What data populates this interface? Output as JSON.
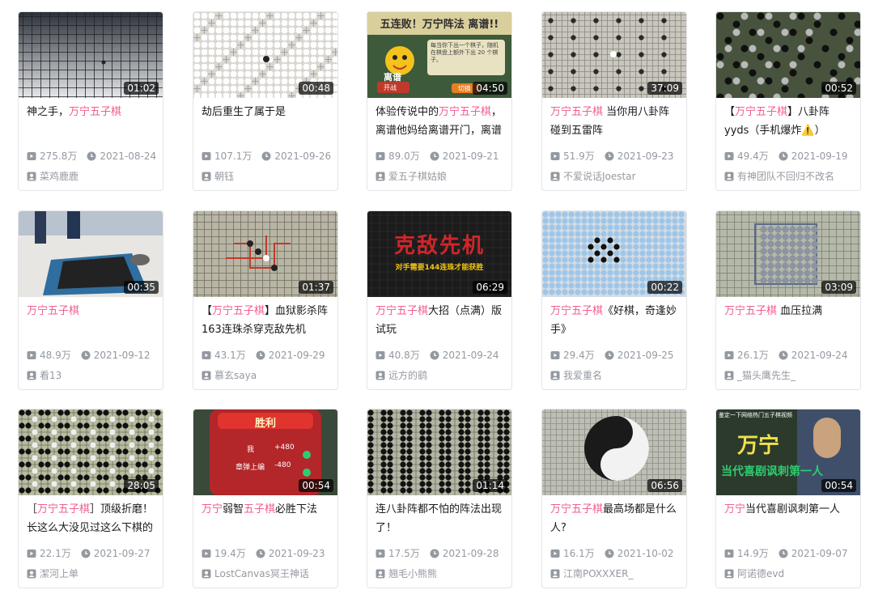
{
  "cards": [
    {
      "duration": "01:02",
      "title": [
        {
          "t": "神之手，",
          "h": false
        },
        {
          "t": "万宁五子棋",
          "h": true
        }
      ],
      "views": "275.8万",
      "date": "2021-08-24",
      "author": "菜鸡鹿鹿",
      "thumb": "board-dark"
    },
    {
      "duration": "00:48",
      "title": [
        {
          "t": "劫后重生了属于是",
          "h": false
        }
      ],
      "views": "107.1万",
      "date": "2021-09-26",
      "author": "朝钰",
      "thumb": "board-white"
    },
    {
      "duration": "04:50",
      "title": [
        {
          "t": "体验传说中的",
          "h": false
        },
        {
          "t": "万宁五子棋",
          "h": true
        },
        {
          "t": "，离谱他妈给离谱开门，离谱",
          "h": false
        }
      ],
      "views": "89.0万",
      "date": "2021-09-21",
      "author": "爱五子棋姑娘",
      "thumb": "game-cartoon",
      "thumb_text": {
        "banner": "五连败！万宁阵法 离谱!!",
        "hint": "每当你下出一个棋子，随机在棋盘上额外下出 20 个棋子。",
        "label": "离谱",
        "btn_left": "开战",
        "btn_right": "切换"
      }
    },
    {
      "duration": "37:09",
      "title": [
        {
          "t": "万宁五子棋",
          "h": true
        },
        {
          "t": " 当你用八卦阵碰到五雷阵",
          "h": false
        }
      ],
      "views": "51.9万",
      "date": "2021-09-23",
      "author": "不爱说话Joestar",
      "thumb": "board-light"
    },
    {
      "duration": "00:52",
      "title": [
        {
          "t": "【",
          "h": false
        },
        {
          "t": "万宁五子棋",
          "h": true
        },
        {
          "t": "】八卦阵yyds（手机爆炸⚠️）",
          "h": false
        }
      ],
      "views": "49.4万",
      "date": "2021-09-19",
      "author": "有神团队不回归不改名",
      "thumb": "board-yinyang"
    },
    {
      "duration": "00:35",
      "title": [
        {
          "t": "万宁五子棋",
          "h": true
        }
      ],
      "views": "48.9万",
      "date": "2021-09-12",
      "author": "看13",
      "thumb": "photo-table"
    },
    {
      "duration": "01:37",
      "title": [
        {
          "t": "【",
          "h": false
        },
        {
          "t": "万宁五子棋",
          "h": true
        },
        {
          "t": "】血狱影杀阵163连珠杀穿克敌先机",
          "h": false
        }
      ],
      "views": "43.1万",
      "date": "2021-09-29",
      "author": "慕玄saya",
      "thumb": "board-red"
    },
    {
      "duration": "06:29",
      "title": [
        {
          "t": "万宁五子棋",
          "h": true
        },
        {
          "t": "大招（点满）版试玩",
          "h": false
        }
      ],
      "views": "40.8万",
      "date": "2021-09-24",
      "author": "远方的鹞",
      "thumb": "text-red",
      "thumb_text": {
        "big": "克敌先机",
        "sub": "对手需要144连珠才能获胜"
      }
    },
    {
      "duration": "00:22",
      "title": [
        {
          "t": "万宁五子棋",
          "h": true
        },
        {
          "t": "《好棋，奇逢妙手》",
          "h": false
        }
      ],
      "views": "29.4万",
      "date": "2021-09-25",
      "author": "我爱重名",
      "thumb": "board-blue"
    },
    {
      "duration": "03:09",
      "title": [
        {
          "t": "万宁五子棋",
          "h": true
        },
        {
          "t": " 血压拉满",
          "h": false
        }
      ],
      "views": "26.1万",
      "date": "2021-09-24",
      "author": "_猫头鹰先生_",
      "thumb": "board-square"
    },
    {
      "duration": "28:05",
      "title": [
        {
          "t": "［",
          "h": false
        },
        {
          "t": "万宁五子棋",
          "h": true
        },
        {
          "t": "］顶级折磨！长这么大没见过这么下棋的",
          "h": false
        }
      ],
      "views": "22.1万",
      "date": "2021-09-27",
      "author": "潔河上单",
      "thumb": "board-rows"
    },
    {
      "duration": "00:54",
      "title": [
        {
          "t": "万宁",
          "h": true
        },
        {
          "t": "弱智",
          "h": false
        },
        {
          "t": "五子棋",
          "h": true
        },
        {
          "t": "必胜下法",
          "h": false
        }
      ],
      "views": "19.4万",
      "date": "2021-09-23",
      "author": "LostCanvas冥王神话",
      "thumb": "scroll-red",
      "thumb_text": {
        "banner": "胜利",
        "r1": "我",
        "r1v": "+480",
        "r2": "章弹上编",
        "r2v": "-480"
      }
    },
    {
      "duration": "01:14",
      "title": [
        {
          "t": "连八卦阵都不怕的阵法出现了！",
          "h": false
        }
      ],
      "views": "17.5万",
      "date": "2021-09-28",
      "author": "翘毛小熊熊",
      "thumb": "board-black"
    },
    {
      "duration": "06:56",
      "title": [
        {
          "t": "万宁五子棋",
          "h": true
        },
        {
          "t": "最高场都是什么人?",
          "h": false
        }
      ],
      "views": "16.1万",
      "date": "2021-10-02",
      "author": "江南POXXXER_",
      "thumb": "board-taiji"
    },
    {
      "duration": "00:54",
      "title": [
        {
          "t": "万宁",
          "h": true
        },
        {
          "t": "当代喜剧讽刺第一人",
          "h": false
        }
      ],
      "views": "14.9万",
      "date": "2021-09-07",
      "author": "阿诺德evd",
      "thumb": "photo-text",
      "thumb_text": {
        "small": "鉴定一下网络热门五子棋视频",
        "big": "万宁",
        "sub": "当代喜剧讽刺第一人"
      }
    }
  ]
}
